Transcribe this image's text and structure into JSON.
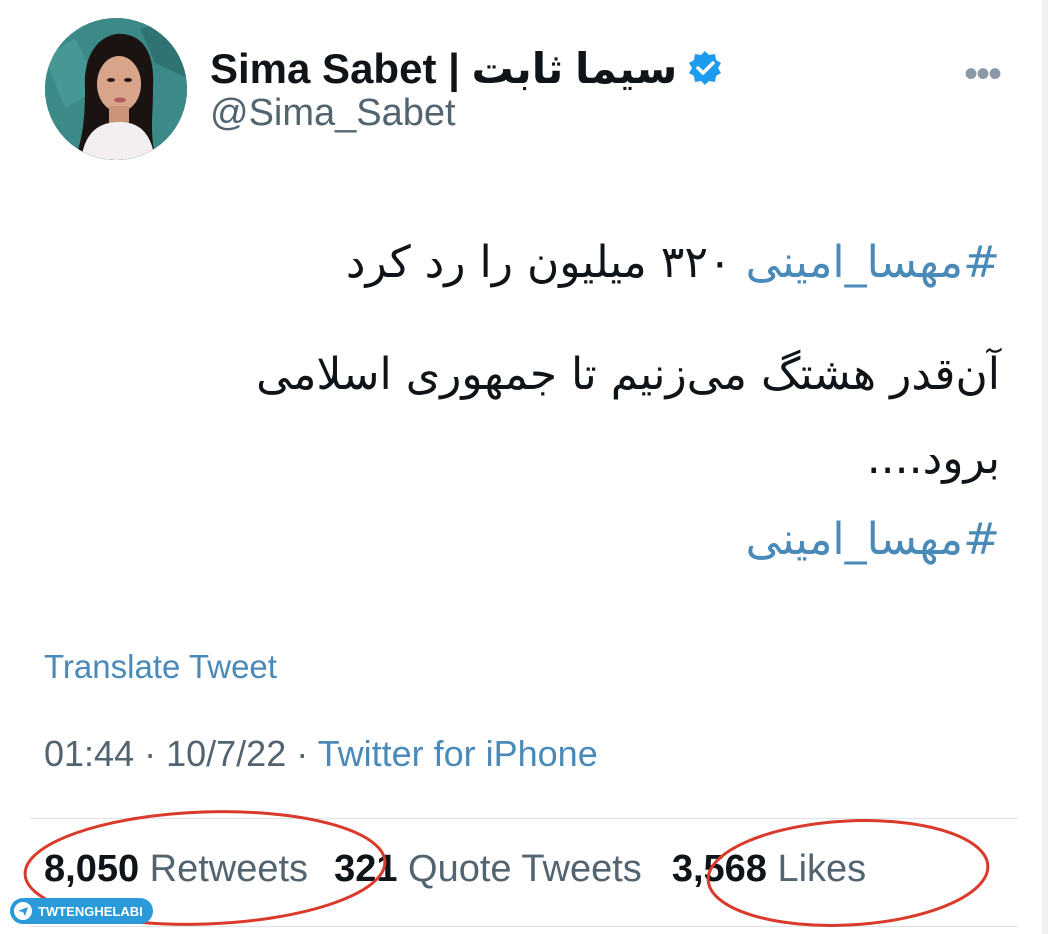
{
  "profile": {
    "display_name": "Sima Sabet | سیما ثابت",
    "handle": "@Sima_Sabet",
    "verified": true,
    "avatar_icon": "person-avatar"
  },
  "tweet": {
    "line1_hashtag": "#مهسا_امینی",
    "line1_text": "۳۲۰ میلیون را رد کرد",
    "line2": "آن‌قدر هشتگ می‌زنیم تا جمهوری اسلامی",
    "line3": "برود....",
    "line4_hashtag": "#مهسا_امینی"
  },
  "translate_label": "Translate Tweet",
  "meta": {
    "time": "01:44",
    "date": "10/7/22",
    "source": "Twitter for iPhone"
  },
  "stats": {
    "retweets_count": "8,050",
    "retweets_label": "Retweets",
    "quotes_count": "321",
    "quotes_label": "Quote Tweets",
    "likes_count": "3,568",
    "likes_label": "Likes"
  },
  "watermark": "TWTENGHELABI",
  "colors": {
    "link": "#4a8ab8",
    "annotation": "#d93a2b",
    "verified": "#1d9bf0"
  }
}
